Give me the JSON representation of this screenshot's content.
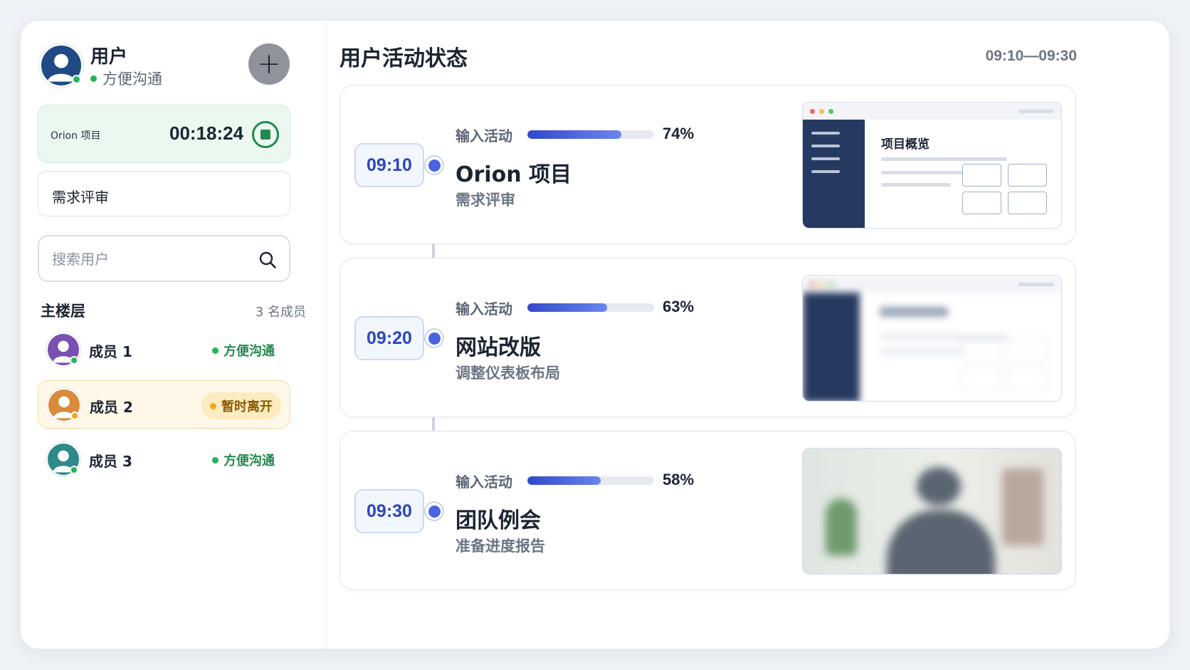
{
  "user": {
    "name": "用户",
    "status": "方便沟通",
    "add_label": "+"
  },
  "timer": {
    "project": "Orion 项目",
    "elapsed": "00:18:24"
  },
  "current_task": "需求评审",
  "search": {
    "placeholder": "搜索用户"
  },
  "floor": {
    "title": "主楼层",
    "count": "3 名成员",
    "members": [
      {
        "name": "成员 1",
        "status": "方便沟通",
        "avatar_color": "#7b4fb3"
      },
      {
        "name": "成员 2",
        "status": "暂时离开",
        "avatar_color": "#d98a3a"
      },
      {
        "name": "成员 3",
        "status": "方便沟通",
        "avatar_color": "#2f8a8a"
      }
    ]
  },
  "main": {
    "title": "用户活动状态",
    "range": "09:10—09:30",
    "activity_label": "输入活动",
    "entries": [
      {
        "time": "09:10",
        "pct_text": "74%",
        "progress": 0.74,
        "title": "Orion 项目",
        "subtitle": "需求评审",
        "preview_title": "项目概览"
      },
      {
        "time": "09:20",
        "pct_text": "63%",
        "progress": 0.63,
        "title": "网站改版",
        "subtitle": "调整仪表板布局"
      },
      {
        "time": "09:30",
        "pct_text": "58%",
        "progress": 0.58,
        "title": "团队例会",
        "subtitle": "准备进度报告"
      }
    ]
  },
  "colors": {
    "accent": "#4865e0",
    "available": "#22b557",
    "away": "#f0a81a",
    "sidebar_dark": "#263a61"
  }
}
